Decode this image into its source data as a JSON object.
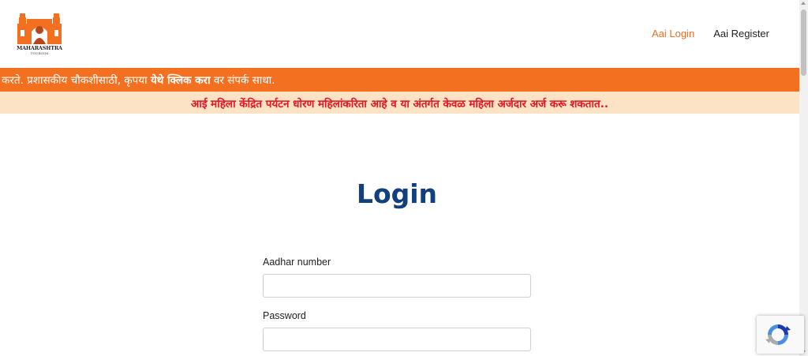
{
  "logo": {
    "name": "MAHARASHTRA",
    "tagline": "TOURISM"
  },
  "nav": {
    "login_label": "Aai Login",
    "register_label": "Aai Register"
  },
  "marquee": {
    "before": "करते. प्रशासकीय चौकशीसाठी, कृपया ",
    "link": "येथे क्लिक करा",
    "after": " वर संपर्क साधा."
  },
  "notice": {
    "text": "आई महिला केंद्रित पर्यटन धोरण महिलांकरिता आहे व या अंतर्गत केवळ महिला अर्जदार अर्ज करू शकतात.."
  },
  "login": {
    "title": "Login",
    "aadhar_label": "Aadhar number",
    "aadhar_value": "",
    "password_label": "Password",
    "password_value": ""
  },
  "colors": {
    "accent_orange": "#f37021",
    "notice_bg": "#fde3c6",
    "notice_text": "#e8141f",
    "title_blue": "#123f7e"
  },
  "icons": {
    "logo": "maharashtra-tourism-emblem",
    "captcha": "recaptcha-icon"
  }
}
